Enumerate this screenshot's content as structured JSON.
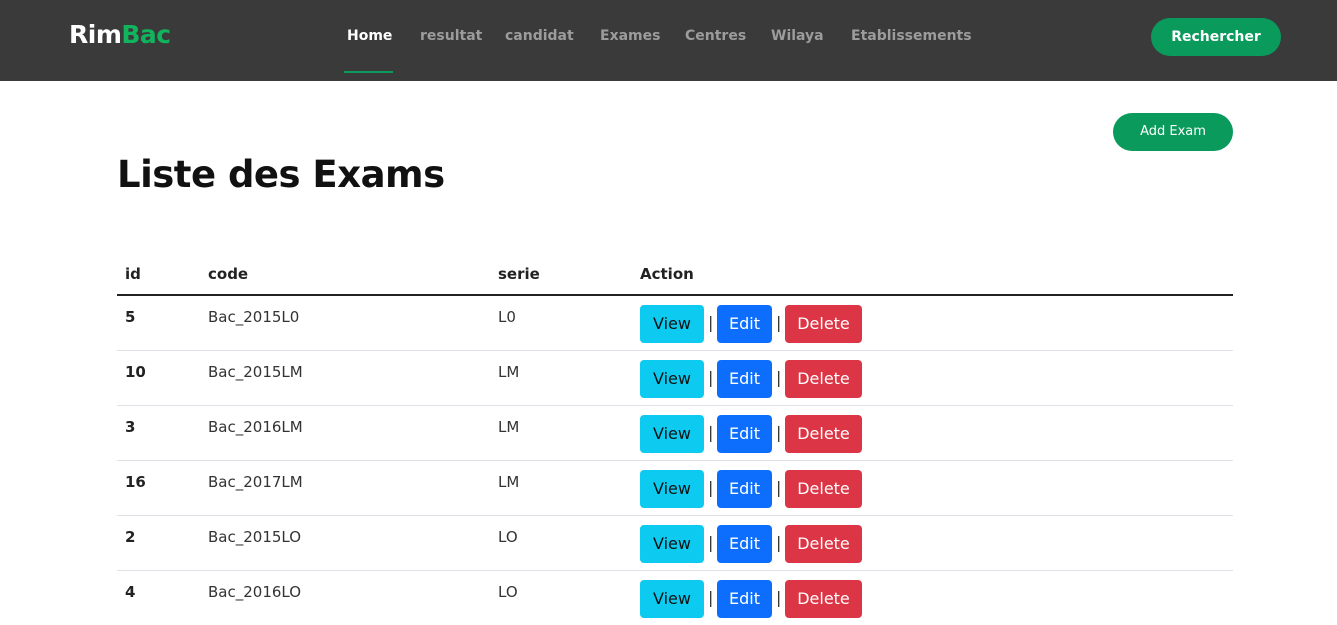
{
  "nav": {
    "logo_part1": "Rim",
    "logo_part2": "Bac",
    "items": [
      {
        "label": "Home"
      },
      {
        "label": "resultat"
      },
      {
        "label": "candidat"
      },
      {
        "label": "Exames"
      },
      {
        "label": "Centres"
      },
      {
        "label": "Wilaya"
      },
      {
        "label": "Etablissements"
      }
    ],
    "search_button": "Rechercher"
  },
  "page": {
    "title": "Liste des Exams",
    "add_button": "Add Exam"
  },
  "table": {
    "headers": {
      "id": "id",
      "code": "code",
      "serie": "serie",
      "action": "Action"
    },
    "rows": [
      {
        "id": "5",
        "code": "Bac_2015L0",
        "serie": "L0"
      },
      {
        "id": "10",
        "code": "Bac_2015LM",
        "serie": "LM"
      },
      {
        "id": "3",
        "code": "Bac_2016LM",
        "serie": "LM"
      },
      {
        "id": "16",
        "code": "Bac_2017LM",
        "serie": "LM"
      },
      {
        "id": "2",
        "code": "Bac_2015LO",
        "serie": "LO"
      },
      {
        "id": "4",
        "code": "Bac_2016LO",
        "serie": "LO"
      }
    ],
    "action_labels": {
      "view": "View",
      "separator": "|",
      "edit": "Edit",
      "delete": "Delete"
    }
  },
  "colors": {
    "navbar_bg": "#3a3a3a",
    "brand_green": "#0a9a5c",
    "view": "#0dcaf0",
    "edit": "#0d6efd",
    "delete": "#dc3545"
  }
}
